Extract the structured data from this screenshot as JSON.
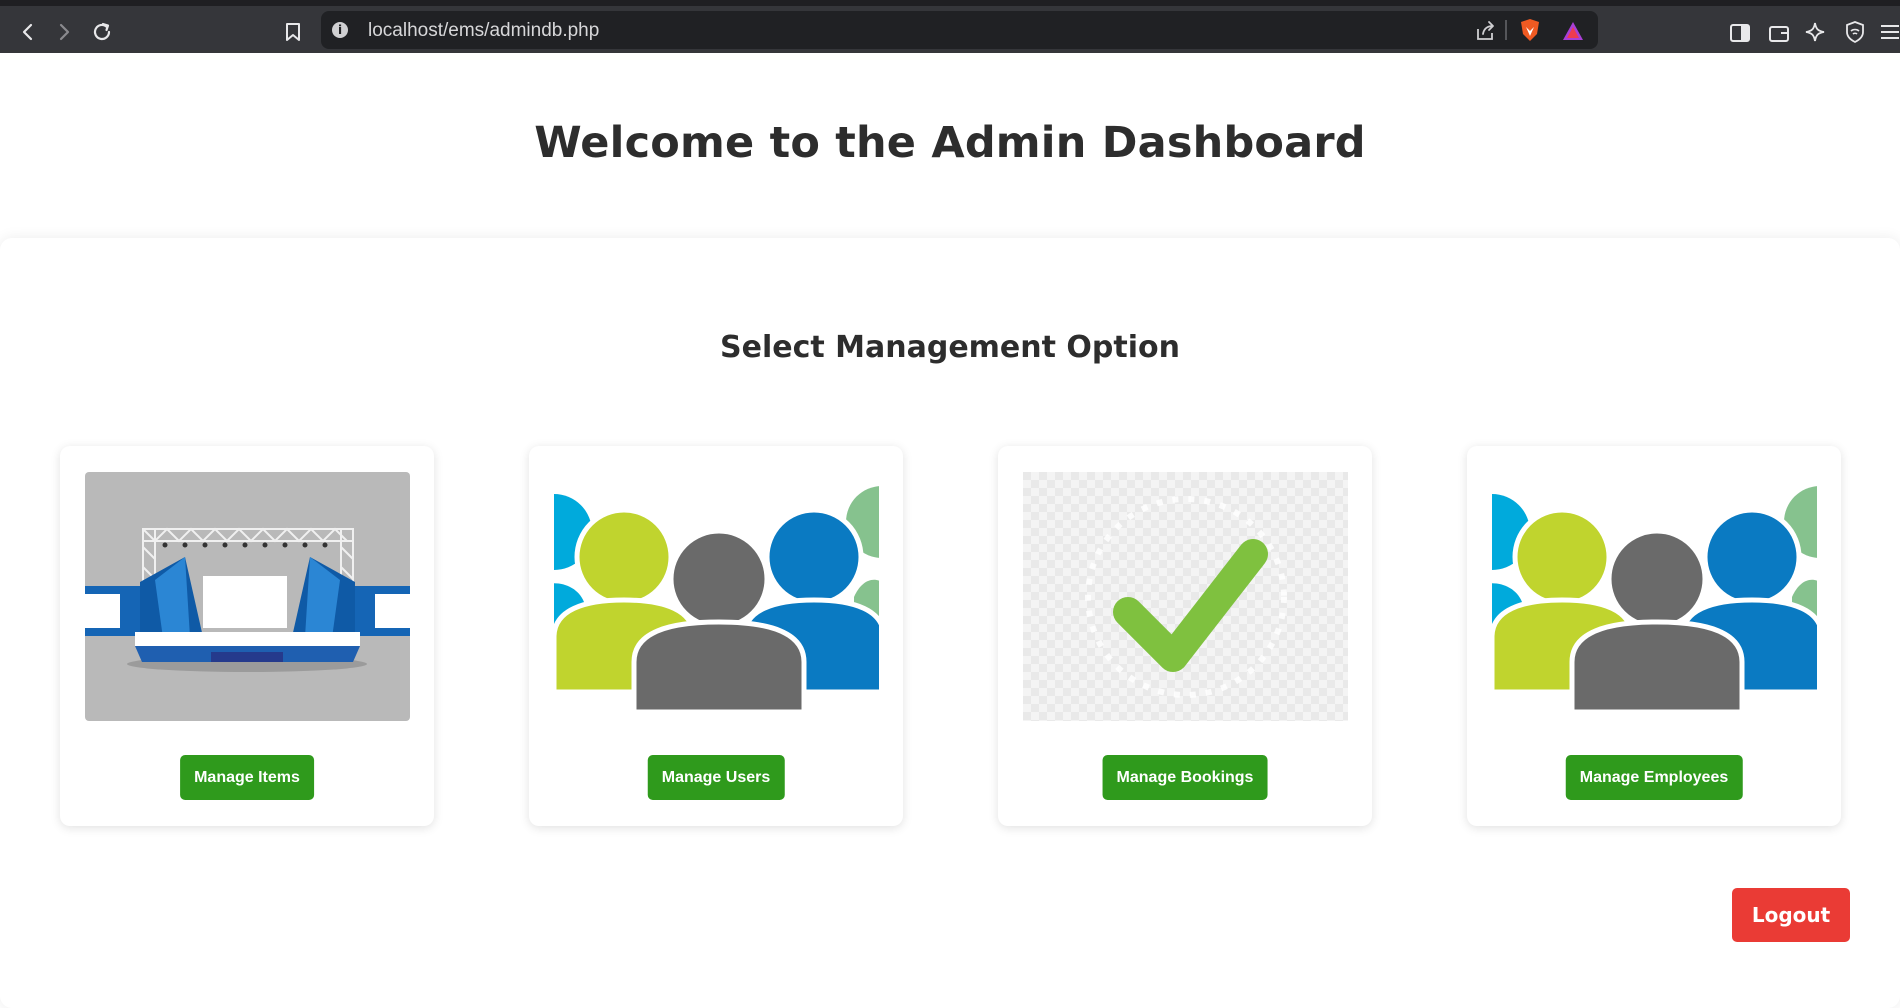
{
  "browser": {
    "url": "localhost/ems/admindb.php",
    "icons": [
      "back-icon",
      "forward-icon",
      "reload-icon",
      "bookmark-icon",
      "site-info-icon",
      "share-icon",
      "brave-shield-icon",
      "brave-rewards-icon",
      "sidebar-icon",
      "wallet-icon",
      "leo-ai-icon",
      "vpn-icon",
      "menu-icon"
    ]
  },
  "page": {
    "title": "Welcome to the Admin Dashboard",
    "section_title": "Select Management Option"
  },
  "cards": [
    {
      "image": "event-stage-image",
      "button_label": "Manage Items"
    },
    {
      "image": "users-group-image",
      "button_label": "Manage Users"
    },
    {
      "image": "checkmark-image",
      "button_label": "Manage Bookings"
    },
    {
      "image": "users-group-image",
      "button_label": "Manage Employees"
    }
  ],
  "logout_label": "Logout",
  "colors": {
    "button_green": "#2f9a1c",
    "logout_red": "#ea3b35",
    "text_dark": "#2d2d2d",
    "people_lime": "#c0d42e",
    "people_blue": "#0a7ac2",
    "people_gray": "#6a6a6a",
    "people_cyan": "#00aadc",
    "people_mint": "#86c28e",
    "check_green": "#7fc13f"
  }
}
